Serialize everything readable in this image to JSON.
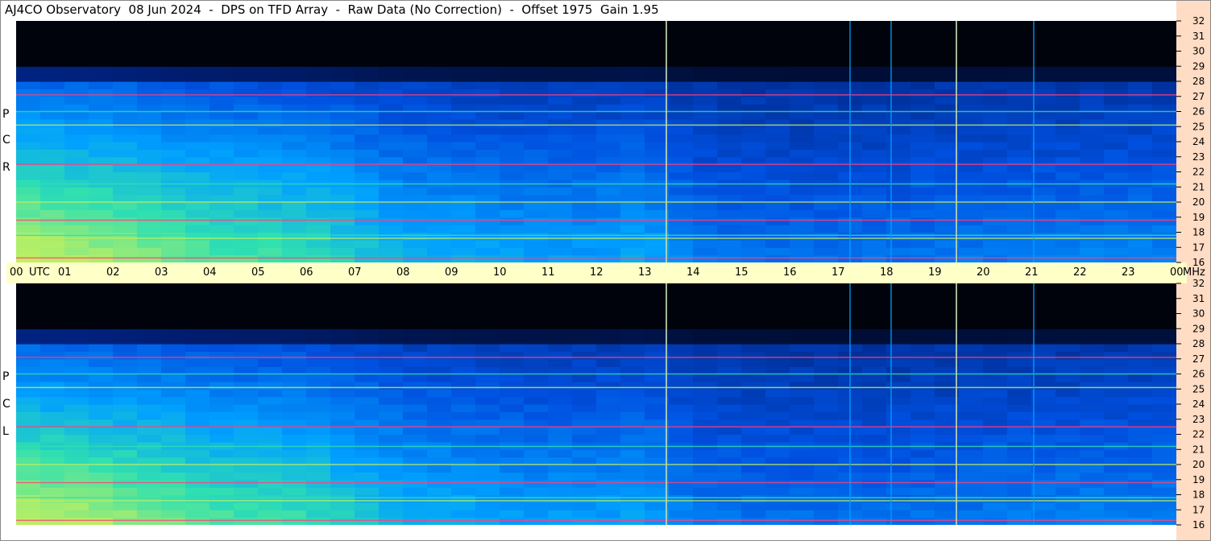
{
  "title": "AJ4CO Observatory  08 Jun 2024  -  DPS on TFD Array  -  Raw Data (No Correction)  -  Offset 1975  Gain 1.95",
  "time_axis": {
    "labels": [
      "00",
      "01",
      "02",
      "03",
      "04",
      "05",
      "06",
      "07",
      "08",
      "09",
      "10",
      "11",
      "12",
      "13",
      "14",
      "15",
      "16",
      "17",
      "18",
      "19",
      "20",
      "21",
      "22",
      "23",
      "00"
    ],
    "utc_label": "UTC",
    "unit_label": "MHz"
  },
  "colors": {
    "background": "#000000",
    "utc_bar": "#ffffc8",
    "right_column": "#ffdcc4"
  },
  "panels": [
    {
      "id": "rcp",
      "polarization_letters": [
        "R",
        "C",
        "P"
      ]
    },
    {
      "id": "lcp",
      "polarization_letters": [
        "L",
        "C",
        "P"
      ]
    }
  ],
  "chart_data": {
    "type": "heatmap",
    "title": "AJ4CO Observatory  08 Jun 2024  -  DPS on TFD Array  -  Raw Data (No Correction)  -  Offset 1975  Gain 1.95",
    "x": {
      "label": "UTC",
      "unit": "hour",
      "range": [
        0,
        24
      ],
      "ticks": [
        0,
        1,
        2,
        3,
        4,
        5,
        6,
        7,
        8,
        9,
        10,
        11,
        12,
        13,
        14,
        15,
        16,
        17,
        18,
        19,
        20,
        21,
        22,
        23,
        24
      ]
    },
    "y": {
      "label": "MHz",
      "range": [
        16,
        32
      ],
      "ticks": [
        16,
        17,
        18,
        19,
        20,
        21,
        22,
        23,
        24,
        25,
        26,
        27,
        28,
        29,
        30,
        31,
        32
      ]
    },
    "panels": [
      "RCP",
      "LCP"
    ],
    "colormap": [
      "#000000",
      "#00207a",
      "#0050e0",
      "#00a0ff",
      "#30e0b0",
      "#c0f060",
      "#ff4080"
    ],
    "persistent_rfi_mhz": [
      16.3,
      17.6,
      17.8,
      18.8,
      20.0,
      21.2,
      22.5,
      25.1,
      26.0,
      27.1
    ],
    "vertical_lines_hours": [
      13.45,
      17.25,
      18.1,
      19.45,
      21.05
    ],
    "intensity_profile": [
      {
        "hour": 0,
        "level": 0.78
      },
      {
        "hour": 2,
        "level": 0.72
      },
      {
        "hour": 4,
        "level": 0.62
      },
      {
        "hour": 6,
        "level": 0.58
      },
      {
        "hour": 8,
        "level": 0.45
      },
      {
        "hour": 10,
        "level": 0.4
      },
      {
        "hour": 12,
        "level": 0.38
      },
      {
        "hour": 13,
        "level": 0.42
      },
      {
        "hour": 14,
        "level": 0.3
      },
      {
        "hour": 16,
        "level": 0.28
      },
      {
        "hour": 18,
        "level": 0.28
      },
      {
        "hour": 20,
        "level": 0.3
      },
      {
        "hour": 22,
        "level": 0.32
      },
      {
        "hour": 24,
        "level": 0.32
      }
    ],
    "grid": false
  }
}
